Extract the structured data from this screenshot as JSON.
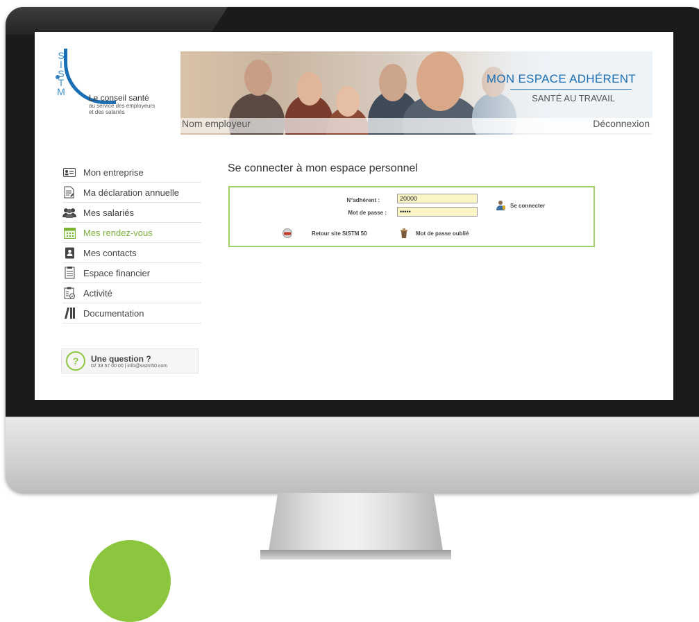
{
  "header": {
    "logo_letters": [
      "S",
      "I",
      "S",
      "T",
      "M"
    ],
    "logo_tagline": "Le conseil santé",
    "logo_tagline_line2": "au service des employeurs",
    "logo_tagline_line3": "et des salariés",
    "brand_title": "MON ESPACE ADHÉRENT",
    "brand_subtitle": "SANTÉ AU TRAVAIL",
    "employer_name": "Nom employeur",
    "logout_label": "Déconnexion"
  },
  "sidebar": {
    "items": [
      {
        "label": "Mon entreprise",
        "icon": "id-card-icon",
        "active": false
      },
      {
        "label": "Ma déclaration annuelle",
        "icon": "document-edit-icon",
        "active": false
      },
      {
        "label": "Mes salariés",
        "icon": "people-icon",
        "active": false
      },
      {
        "label": "Mes rendez-vous",
        "icon": "calendar-icon",
        "active": true
      },
      {
        "label": "Mes contacts",
        "icon": "contact-book-icon",
        "active": false
      },
      {
        "label": "Espace financier",
        "icon": "invoice-icon",
        "active": false
      },
      {
        "label": "Activité",
        "icon": "clipboard-check-icon",
        "active": false
      },
      {
        "label": "Documentation",
        "icon": "binders-icon",
        "active": false
      }
    ],
    "question": {
      "title": "Une question ?",
      "contact": "02 33 57 00 00 | info@sistm50.com"
    }
  },
  "main": {
    "title": "Se connecter à mon espace personnel",
    "login": {
      "member_label": "N°adhérent :",
      "member_value": "20000",
      "password_label": "Mot de passe :",
      "password_value": "•••••",
      "connect_label": "Se connecter",
      "back_label": "Retour site SISTM 50",
      "forgot_label": "Mot de passe oublié"
    }
  },
  "colors": {
    "accent_green": "#8cc63f",
    "brand_blue": "#1b6fb5",
    "active_text": "#7bb33a",
    "input_bg": "#fbf5c6"
  }
}
